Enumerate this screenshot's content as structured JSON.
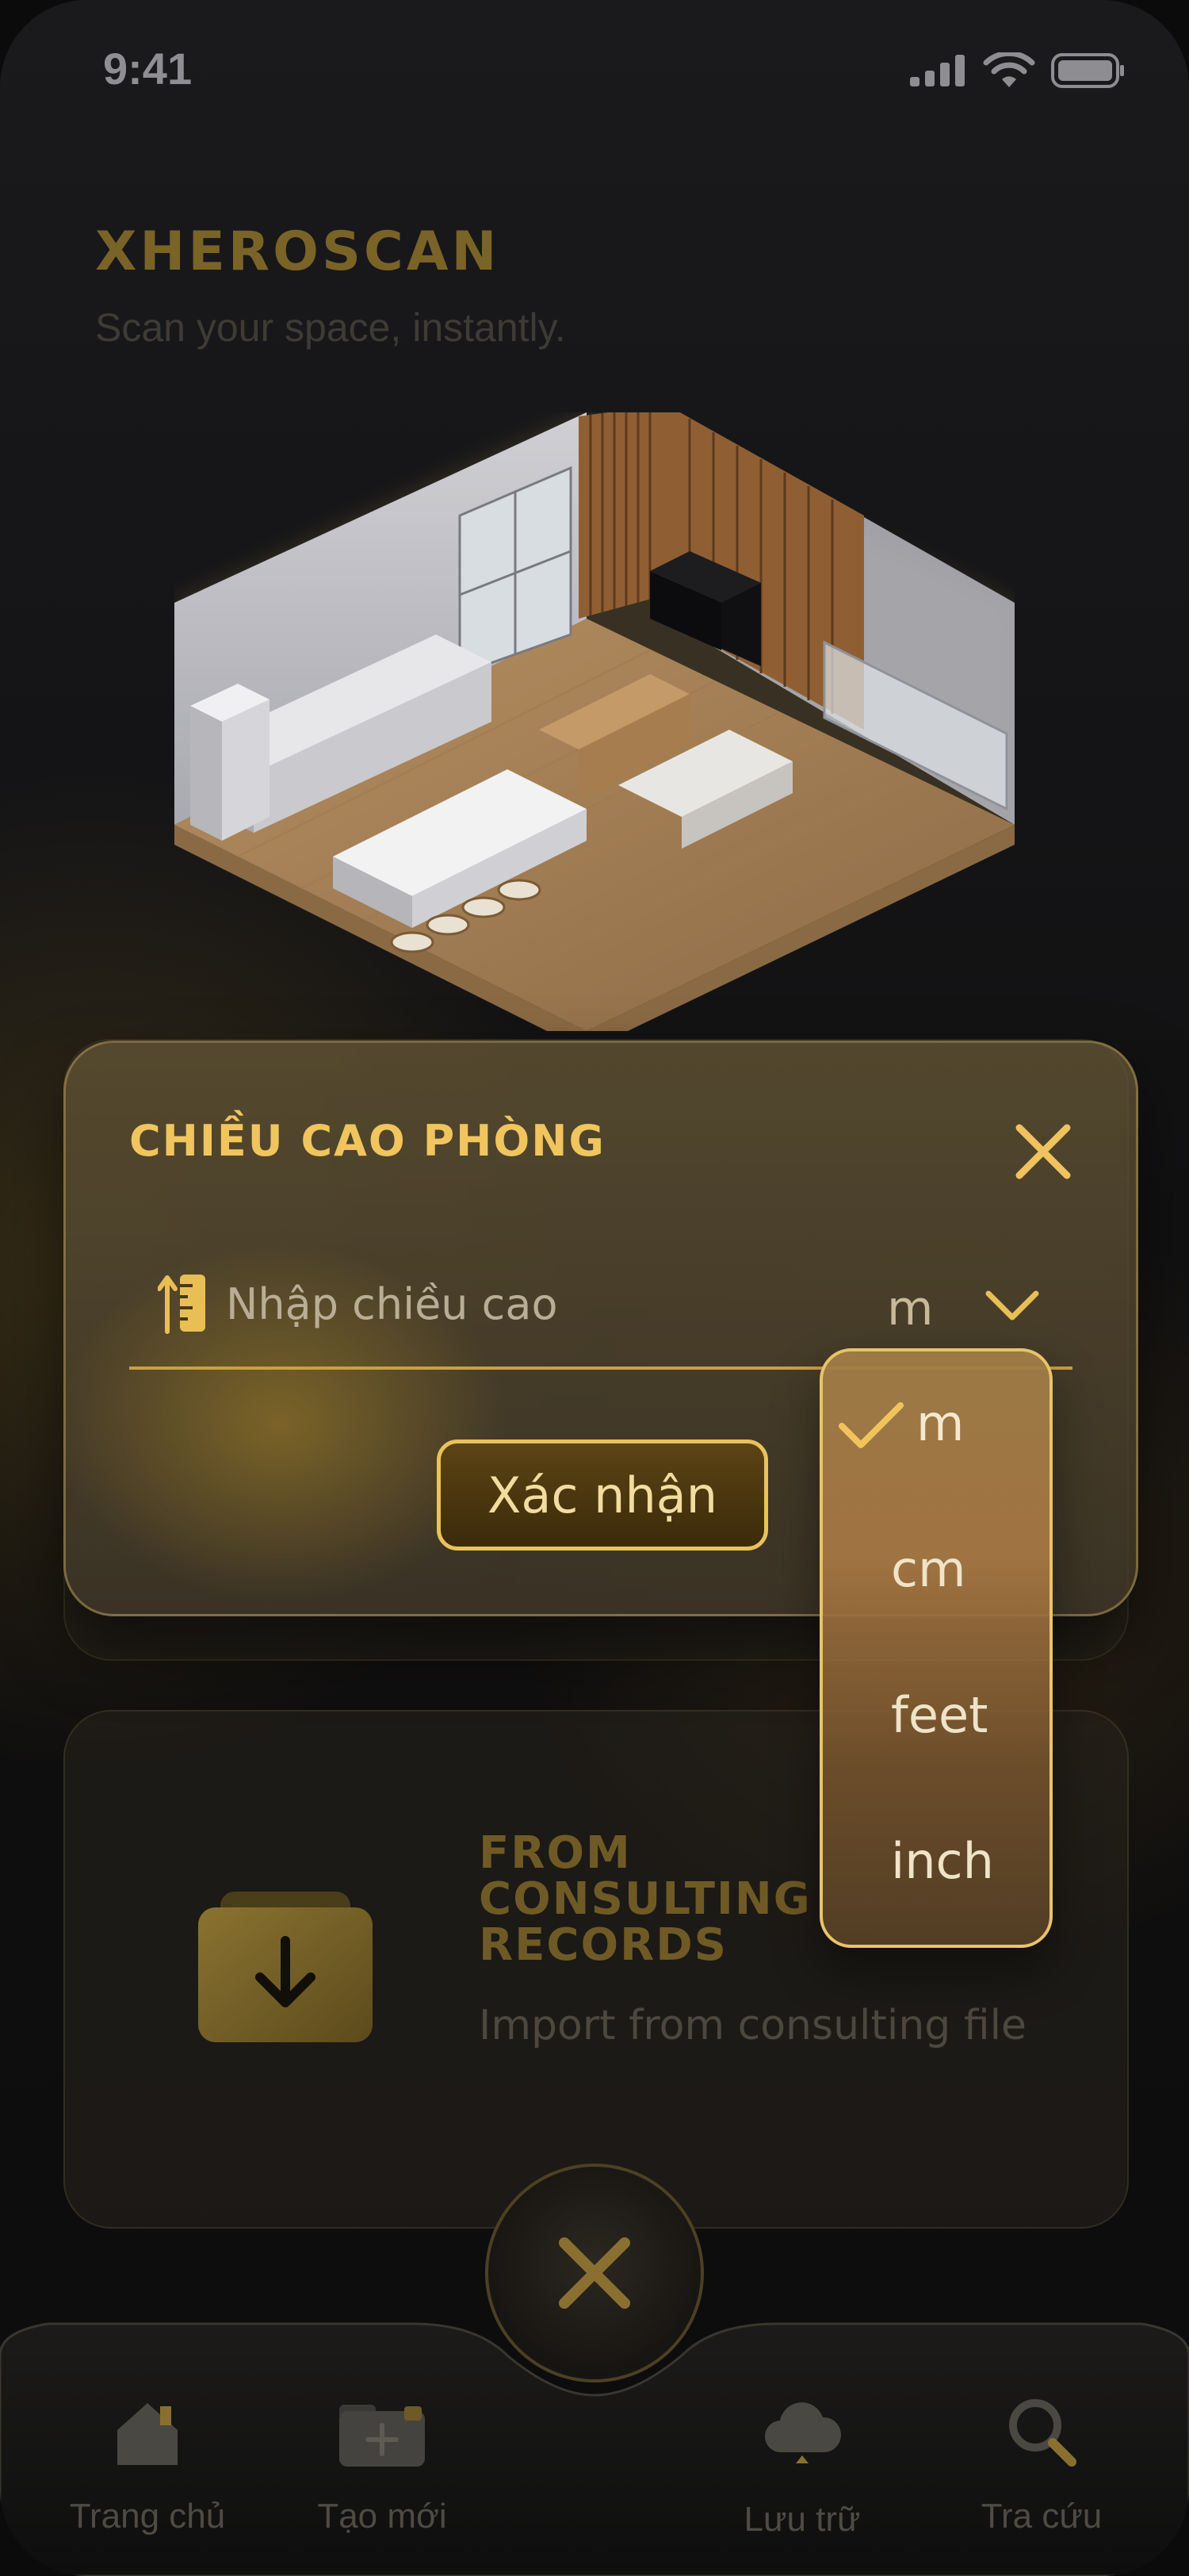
{
  "status_bar": {
    "time": "9:41"
  },
  "header": {
    "brand": "XHEROSCAN",
    "tagline": "Scan your space, instantly."
  },
  "modal": {
    "title": "CHIỀU CAO PHÒNG",
    "input_placeholder": "Nhập chiều cao",
    "input_value": "",
    "unit_selected": "m",
    "confirm_label": "Xác nhận"
  },
  "unit_dropdown": {
    "options": [
      "m",
      "cm",
      "feet",
      "inch"
    ],
    "selected": "m"
  },
  "consulting_card": {
    "title": "FROM CONSULTING RECORDS",
    "subtitle": "Import from consulting file"
  },
  "bottom_nav": {
    "items": [
      {
        "label": "Trang chủ",
        "icon": "home-icon"
      },
      {
        "label": "Tạo mới",
        "icon": "folder-add-icon"
      },
      {
        "label": "Lưu trữ",
        "icon": "cloud-download-icon"
      },
      {
        "label": "Tra cứu",
        "icon": "search-icon"
      }
    ],
    "center_button_icon": "close-icon"
  },
  "colors": {
    "accent_gold": "#f1c55e",
    "gold_dim": "#7a6326",
    "background": "#141416"
  }
}
